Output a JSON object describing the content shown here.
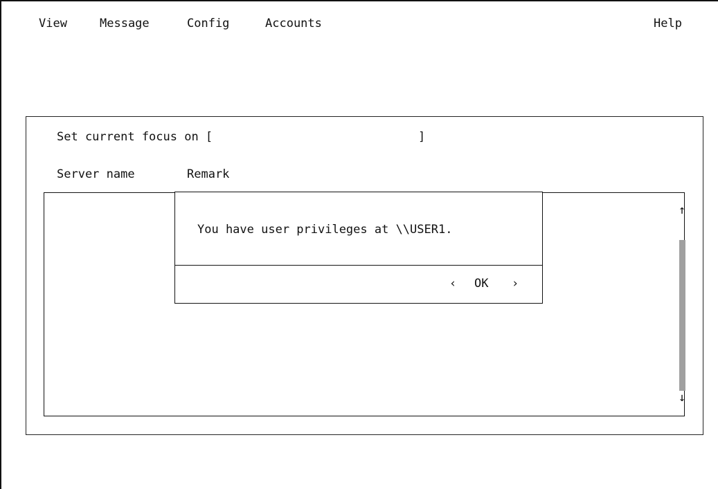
{
  "menu_bar": {
    "items": [
      "View",
      "Message",
      "Config",
      "Accounts"
    ],
    "help": "Help"
  },
  "panel": {
    "focus_label": "Set current focus on [",
    "focus_value": "",
    "focus_close_bracket": "]",
    "columns": [
      "Server name",
      "Remark"
    ]
  },
  "scrollbar": {
    "up_arrow": "↑",
    "down_arrow": "↓"
  },
  "dialog": {
    "message": "You have user privileges at \\\\USER1.",
    "ok_left_bracket": "‹",
    "ok_label": "OK",
    "ok_right_bracket": "›"
  }
}
